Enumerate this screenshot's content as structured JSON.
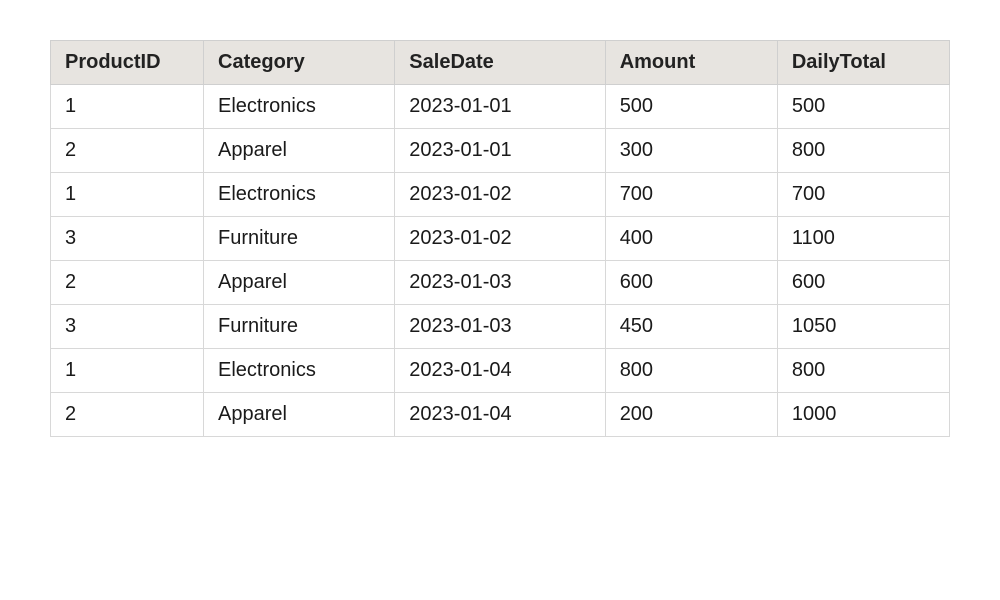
{
  "table": {
    "headers": {
      "productid": "ProductID",
      "category": "Category",
      "saledate": "SaleDate",
      "amount": "Amount",
      "dailytotal": "DailyTotal"
    },
    "rows": [
      {
        "productid": "1",
        "category": "Electronics",
        "saledate": "2023-01-01",
        "amount": "500",
        "dailytotal": "500"
      },
      {
        "productid": "2",
        "category": "Apparel",
        "saledate": "2023-01-01",
        "amount": "300",
        "dailytotal": "800"
      },
      {
        "productid": "1",
        "category": "Electronics",
        "saledate": "2023-01-02",
        "amount": "700",
        "dailytotal": "700"
      },
      {
        "productid": "3",
        "category": "Furniture",
        "saledate": "2023-01-02",
        "amount": "400",
        "dailytotal": "1100"
      },
      {
        "productid": "2",
        "category": "Apparel",
        "saledate": "2023-01-03",
        "amount": "600",
        "dailytotal": "600"
      },
      {
        "productid": "3",
        "category": "Furniture",
        "saledate": "2023-01-03",
        "amount": "450",
        "dailytotal": "1050"
      },
      {
        "productid": "1",
        "category": "Electronics",
        "saledate": "2023-01-04",
        "amount": "800",
        "dailytotal": "800"
      },
      {
        "productid": "2",
        "category": "Apparel",
        "saledate": "2023-01-04",
        "amount": "200",
        "dailytotal": "1000"
      }
    ]
  }
}
